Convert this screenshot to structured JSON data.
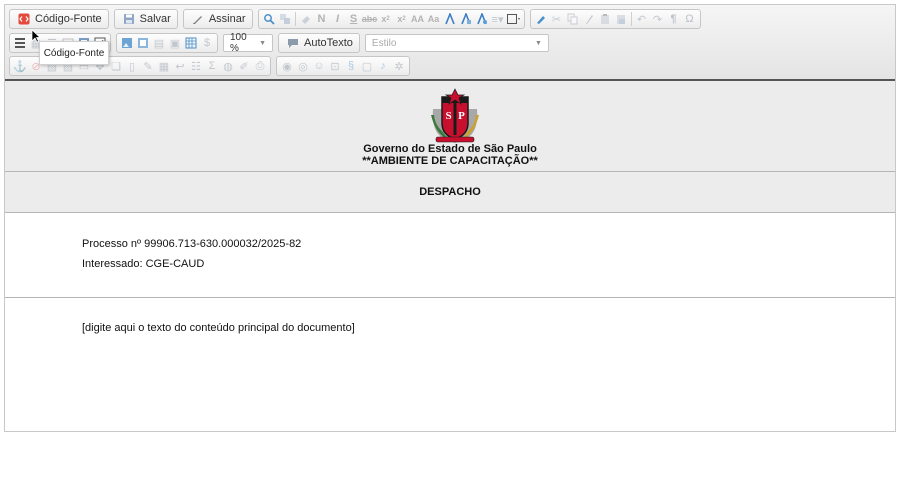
{
  "toolbar": {
    "source_label": "Código-Fonte",
    "save_label": "Salvar",
    "sign_label": "Assinar",
    "zoom_value": "100 %",
    "autotext_label": "AutoTexto",
    "style_placeholder": "Estilo",
    "bold_glyph": "N",
    "italic_glyph": "I",
    "strike_glyph": "S",
    "pilcrow_glyph": "¶",
    "omega_glyph": "Ω",
    "sum_glyph": "Σ"
  },
  "tooltip": {
    "text": "Código-Fonte"
  },
  "document": {
    "header_line1": "Governo do Estado de São Paulo",
    "header_line2": "**AMBIENTE DE CAPACITAÇÃO**",
    "crest_letters": "SP",
    "title": "DESPACHO",
    "process": "Processo nº 99906.713-630.000032/2025-82",
    "interested": "Interessado: CGE-CAUD",
    "body_placeholder": "[digite aqui o texto do conteúdo principal do documento]"
  },
  "colors": {
    "crest_red": "#c8102e",
    "crest_black": "#1a1a1a",
    "toolbar_bg": "#e9e9e9"
  }
}
